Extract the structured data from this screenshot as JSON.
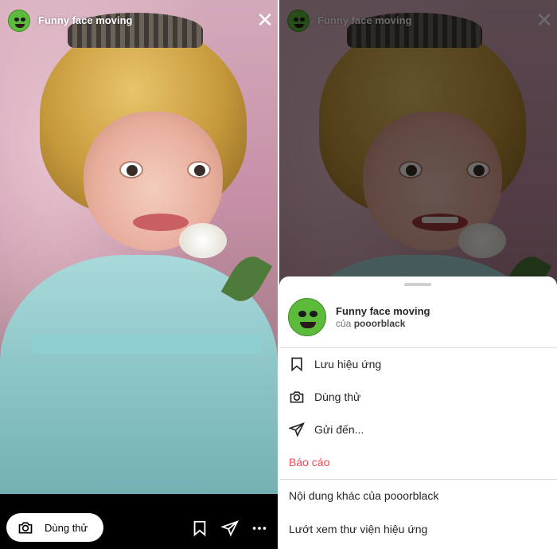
{
  "story": {
    "effect_name": "Funny face moving"
  },
  "bottom_bar": {
    "try_label": "Dùng thử"
  },
  "sheet": {
    "effect_name": "Funny face moving",
    "by_prefix": "của",
    "creator": "pooorblack",
    "actions": [
      {
        "label": "Lưu hiệu ứng",
        "icon": "bookmark-icon"
      },
      {
        "label": "Dùng thử",
        "icon": "camera-icon"
      },
      {
        "label": "Gửi đến...",
        "icon": "send-icon"
      },
      {
        "label": "Báo cáo",
        "icon": ""
      }
    ],
    "more_from": "Nội dung khác của pooorblack",
    "browse_gallery": "Lướt xem thư viện hiệu ứng"
  },
  "colors": {
    "report_red": "#ed4956",
    "avatar_green": "#5dbb3b"
  }
}
